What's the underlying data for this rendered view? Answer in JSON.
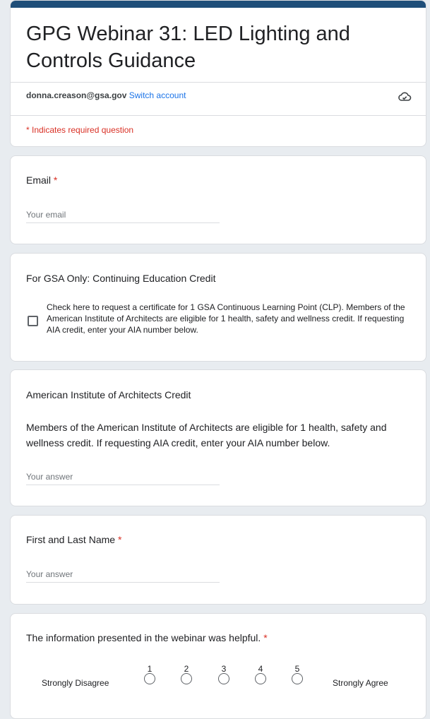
{
  "form": {
    "title": "GPG Webinar 31: LED Lighting and Controls Guidance",
    "account_email": "donna.creason@gsa.gov",
    "switch_account": "Switch account",
    "required_note": "* Indicates required question",
    "accent_color": "#1f4e79"
  },
  "questions": {
    "email": {
      "label": "Email",
      "required_mark": "*",
      "placeholder": "Your email"
    },
    "ce_credit": {
      "label": "For GSA Only: Continuing Education Credit",
      "checkbox_text": "Check here to request a certificate for 1 GSA Continuous Learning Point (CLP). Members of the American Institute of Architects are eligible for 1 health, safety and wellness credit. If requesting AIA credit, enter your AIA number below."
    },
    "aia": {
      "label": "American Institute of Architects Credit",
      "description": "Members of the American Institute of Architects are eligible for 1 health, safety and wellness credit. If requesting AIA credit, enter your AIA number below.",
      "placeholder": "Your answer"
    },
    "name": {
      "label": "First and Last Name",
      "required_mark": "*",
      "placeholder": "Your answer"
    },
    "helpful": {
      "label": "The information presented in the webinar was helpful.",
      "required_mark": "*",
      "scale": [
        "1",
        "2",
        "3",
        "4",
        "5"
      ],
      "low_label": "Strongly Disagree",
      "high_label": "Strongly Agree"
    }
  },
  "icons": {
    "cloud": "cloud-check-icon"
  }
}
